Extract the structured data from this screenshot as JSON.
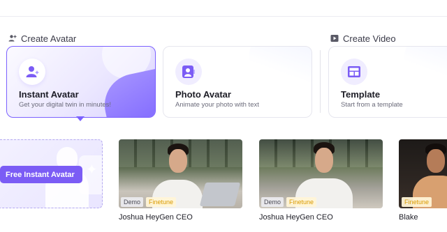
{
  "sections": {
    "create_avatar": {
      "label": "Create Avatar",
      "icon": "person-add-icon"
    },
    "create_video": {
      "label": "Create Video",
      "icon": "play-square-icon"
    }
  },
  "cards": [
    {
      "title": "Instant Avatar",
      "subtitle": "Get your digital twin in minutes!",
      "icon": "person-sparkle-icon",
      "selected": true
    },
    {
      "title": "Photo Avatar",
      "subtitle": "Animate your photo with text",
      "icon": "portrait-photo-icon",
      "selected": false
    },
    {
      "title": "Template",
      "subtitle": "Start from a template",
      "icon": "template-layout-icon",
      "selected": false
    }
  ],
  "free_tile": {
    "button_label": "Free Instant Avatar"
  },
  "avatars": [
    {
      "name": "Joshua HeyGen CEO",
      "tags": [
        "Demo",
        "Finetune"
      ]
    },
    {
      "name": "Joshua HeyGen CEO",
      "tags": [
        "Demo",
        "Finetune"
      ]
    },
    {
      "name": "Blake",
      "tags": [
        "Finetune"
      ]
    }
  ],
  "colors": {
    "accent": "#7b5cf5",
    "finetune_text": "#d99a00"
  }
}
